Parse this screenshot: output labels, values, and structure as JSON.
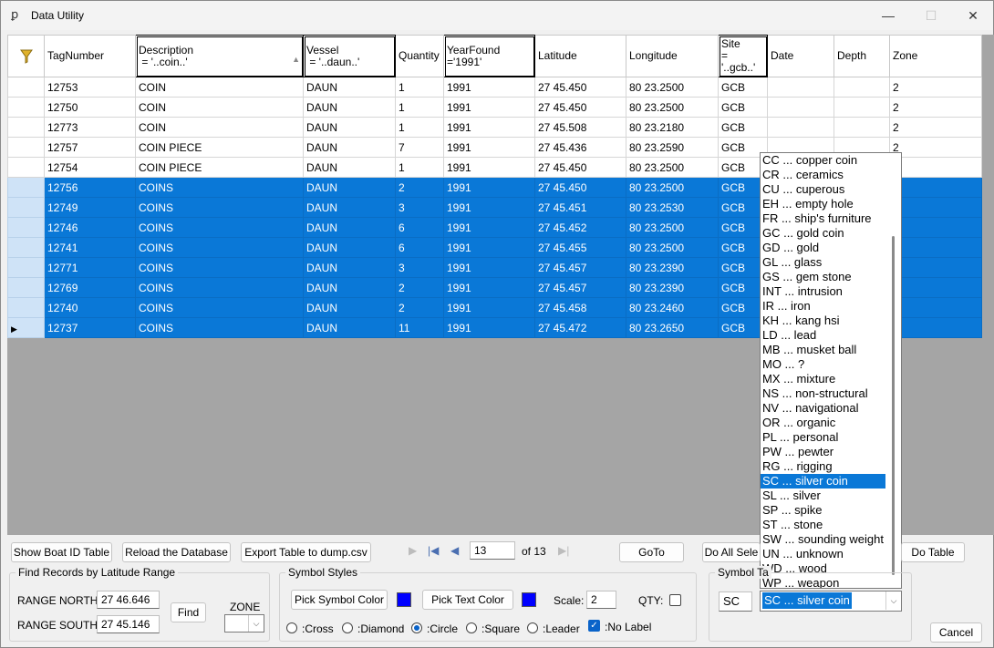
{
  "window": {
    "title": "Data Utility",
    "icon": "app-icon",
    "minimize_label": "—",
    "maximize_label": "☐",
    "close_label": "✕"
  },
  "grid": {
    "columns": [
      {
        "name": "filter",
        "label": "",
        "sub": ""
      },
      {
        "name": "tagnumber",
        "label": "TagNumber",
        "sub": ""
      },
      {
        "name": "description",
        "label": "Description",
        "sub": " = '..coin..'"
      },
      {
        "name": "vessel",
        "label": "Vessel",
        "sub": " = '..daun..'"
      },
      {
        "name": "quantity",
        "label": "Quantity",
        "sub": ""
      },
      {
        "name": "yearfound",
        "label": "YearFound",
        "sub": "='1991'"
      },
      {
        "name": "latitude",
        "label": "Latitude",
        "sub": ""
      },
      {
        "name": "longitude",
        "label": "Longitude",
        "sub": ""
      },
      {
        "name": "site",
        "label": "Site",
        "sub": "=\n'..gcb..'"
      },
      {
        "name": "date",
        "label": "Date",
        "sub": ""
      },
      {
        "name": "depth",
        "label": "Depth",
        "sub": ""
      },
      {
        "name": "zone",
        "label": "Zone",
        "sub": ""
      }
    ],
    "rows": [
      {
        "selected": false,
        "current": false,
        "cells": [
          "12753",
          "COIN",
          "DAUN",
          "1",
          "1991",
          "27 45.450",
          "80 23.2500",
          "GCB",
          "",
          "",
          "2"
        ]
      },
      {
        "selected": false,
        "current": false,
        "cells": [
          "12750",
          "COIN",
          "DAUN",
          "1",
          "1991",
          "27 45.450",
          "80 23.2500",
          "GCB",
          "",
          "",
          "2"
        ]
      },
      {
        "selected": false,
        "current": false,
        "cells": [
          "12773",
          "COIN",
          "DAUN",
          "1",
          "1991",
          "27 45.508",
          "80 23.2180",
          "GCB",
          "",
          "",
          "2"
        ]
      },
      {
        "selected": false,
        "current": false,
        "cells": [
          "12757",
          "COIN PIECE",
          "DAUN",
          "7",
          "1991",
          "27 45.436",
          "80 23.2590",
          "GCB",
          "",
          "",
          "2"
        ]
      },
      {
        "selected": false,
        "current": false,
        "cells": [
          "12754",
          "COIN PIECE",
          "DAUN",
          "1",
          "1991",
          "27 45.450",
          "80 23.2500",
          "GCB",
          "",
          "",
          ""
        ]
      },
      {
        "selected": true,
        "current": false,
        "cells": [
          "12756",
          "COINS",
          "DAUN",
          "2",
          "1991",
          "27 45.450",
          "80 23.2500",
          "GCB",
          "",
          "",
          ""
        ]
      },
      {
        "selected": true,
        "current": false,
        "cells": [
          "12749",
          "COINS",
          "DAUN",
          "3",
          "1991",
          "27 45.451",
          "80 23.2530",
          "GCB",
          "",
          "",
          ""
        ]
      },
      {
        "selected": true,
        "current": false,
        "cells": [
          "12746",
          "COINS",
          "DAUN",
          "6",
          "1991",
          "27 45.452",
          "80 23.2500",
          "GCB",
          "",
          "",
          ""
        ]
      },
      {
        "selected": true,
        "current": false,
        "cells": [
          "12741",
          "COINS",
          "DAUN",
          "6",
          "1991",
          "27 45.455",
          "80 23.2500",
          "GCB",
          "",
          "",
          ""
        ]
      },
      {
        "selected": true,
        "current": false,
        "cells": [
          "12771",
          "COINS",
          "DAUN",
          "3",
          "1991",
          "27 45.457",
          "80 23.2390",
          "GCB",
          "",
          "",
          ""
        ]
      },
      {
        "selected": true,
        "current": false,
        "cells": [
          "12769",
          "COINS",
          "DAUN",
          "2",
          "1991",
          "27 45.457",
          "80 23.2390",
          "GCB",
          "",
          "",
          ""
        ]
      },
      {
        "selected": true,
        "current": false,
        "cells": [
          "12740",
          "COINS",
          "DAUN",
          "2",
          "1991",
          "27 45.458",
          "80 23.2460",
          "GCB",
          "",
          "",
          ""
        ]
      },
      {
        "selected": true,
        "current": true,
        "cells": [
          "12737",
          "COINS",
          "DAUN",
          "11",
          "1991",
          "27 45.472",
          "80 23.2650",
          "GCB",
          "",
          "",
          ""
        ]
      }
    ]
  },
  "dropdown_list": {
    "selected_index": 22,
    "items": [
      "CC ... copper coin",
      "CR ... ceramics",
      "CU ... cuperous",
      "EH ... empty hole",
      "FR ... ship's furniture",
      "GC ... gold coin",
      "GD ... gold",
      "GL ... glass",
      "GS ... gem stone",
      "INT ... intrusion",
      "IR ... iron",
      "KH ... kang hsi",
      "LD ... lead",
      "MB ... musket ball",
      "MO ... ?",
      "MX ... mixture",
      "NS ... non-structural",
      "NV ... navigational",
      "OR ... organic",
      "PL ... personal",
      "PW ... pewter",
      "RG ... rigging",
      "SC ... silver coin",
      "SL ... silver",
      "SP ... spike",
      "ST ... stone",
      "SW ... sounding weight",
      "UN ... unknown",
      "WD ... wood",
      "WP ... weapon"
    ]
  },
  "toolbar": {
    "show_boat_id": "Show Boat ID Table",
    "reload_db": "Reload the Database",
    "export_table": "Export Table to dump.csv",
    "record_current": "13",
    "record_of": "of 13",
    "goto": "GoTo",
    "do_all_select": "Do All Sele",
    "do_table": "Do Table"
  },
  "find_range": {
    "title": "Find Records by Latitude Range",
    "north_label": "RANGE NORTH:",
    "north_value": "27 46.646",
    "south_label": "RANGE SOUTH:",
    "south_value": "27 45.146",
    "find_button": "Find",
    "zone_label": "ZONE",
    "zone_value": ""
  },
  "symbol_styles": {
    "title": "Symbol Styles",
    "pick_symbol_color": "Pick Symbol Color",
    "symbol_color": "#0000ff",
    "pick_text_color": "Pick Text Color",
    "text_color": "#0000ff",
    "scale_label": "Scale:",
    "scale_value": "2",
    "qty_label": "QTY:",
    "qty_checked": false,
    "shapes": [
      {
        "label": ":Cross",
        "checked": false
      },
      {
        "label": ":Diamond",
        "checked": false
      },
      {
        "label": ":Circle",
        "checked": true
      },
      {
        "label": ":Square",
        "checked": false
      },
      {
        "label": ":Leader",
        "checked": false
      }
    ],
    "no_label_label": ":No Label",
    "no_label_checked": true
  },
  "symbol_tag": {
    "title": "Symbol Ta",
    "code_value": "SC",
    "combo_value": "SC ... silver coin"
  },
  "cancel": "Cancel",
  "colors": {
    "selection": "#0a78d7",
    "grid_background": "#a5a5a5"
  }
}
